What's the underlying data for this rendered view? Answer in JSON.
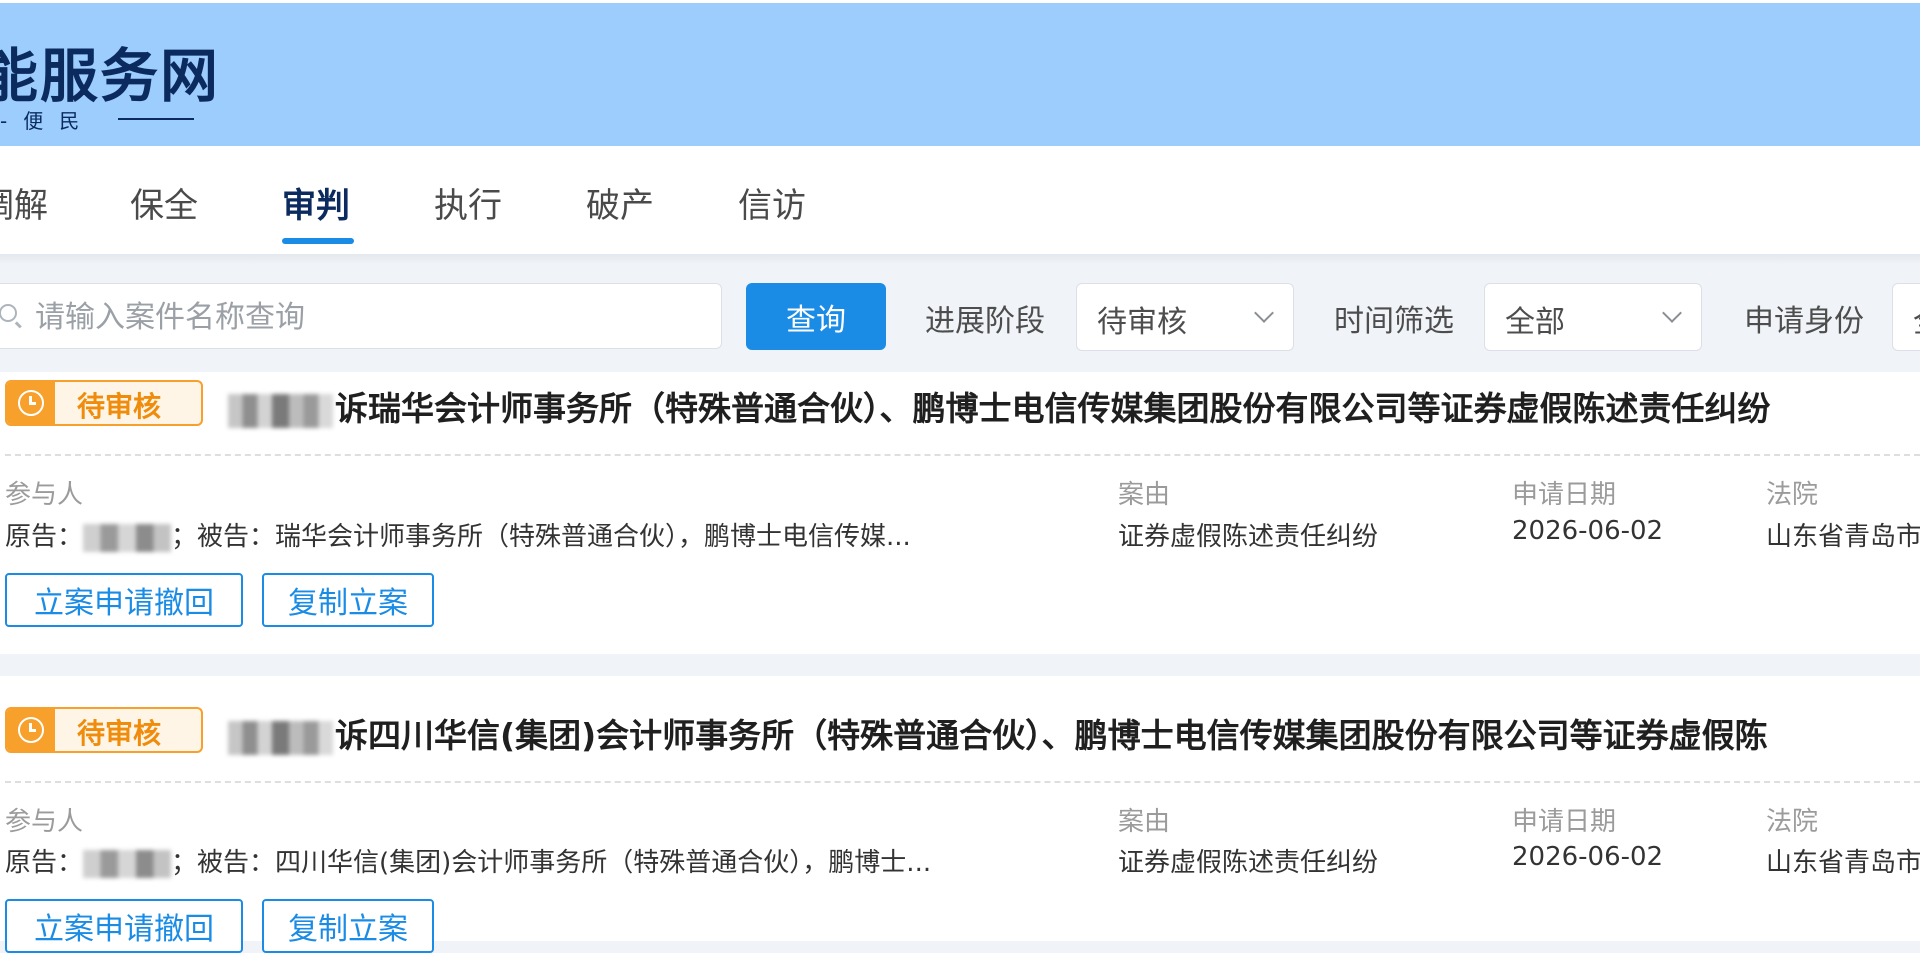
{
  "header": {
    "logo_title": "能服务网",
    "logo_subtitle": "便民",
    "logo_subtitle_lead": "-"
  },
  "nav": {
    "tabs": [
      {
        "label": "调解",
        "active": false
      },
      {
        "label": "保全",
        "active": false
      },
      {
        "label": "审判",
        "active": true
      },
      {
        "label": "执行",
        "active": false
      },
      {
        "label": "破产",
        "active": false
      },
      {
        "label": "信访",
        "active": false
      }
    ]
  },
  "search": {
    "placeholder": "请输入案件名称查询",
    "button_label": "查询"
  },
  "filters": {
    "stage_label": "进展阶段",
    "stage_value": "待审核",
    "time_label": "时间筛选",
    "time_value": "全部",
    "identity_label": "申请身份",
    "identity_value": "全"
  },
  "colors": {
    "header_bg": "#9ccdfd",
    "accent": "#1b8ce5",
    "pending": "#f7a02b"
  },
  "cases": [
    {
      "status": "待审核",
      "title": "诉瑞华会计师事务所（特殊普通合伙）、鹏博士电信传媒集团股份有限公司等证券虚假陈述责任纠纷",
      "participants_label": "参与人",
      "plaintiff_prefix": "原告：",
      "defendant_text": "；被告：瑞华会计师事务所（特殊普通合伙），鹏博士电信传媒...",
      "cause_label": "案由",
      "cause_value": "证券虚假陈述责任纠纷",
      "date_label": "申请日期",
      "date_value": "2026-06-02",
      "court_label": "法院",
      "court_value": "山东省青岛市",
      "actions": [
        "立案申请撤回",
        "复制立案"
      ]
    },
    {
      "status": "待审核",
      "title": "诉四川华信(集团)会计师事务所（特殊普通合伙）、鹏博士电信传媒集团股份有限公司等证券虚假陈",
      "participants_label": "参与人",
      "plaintiff_prefix": "原告：",
      "defendant_text": "；被告：四川华信(集团)会计师事务所（特殊普通合伙），鹏博士...",
      "cause_label": "案由",
      "cause_value": "证券虚假陈述责任纠纷",
      "date_label": "申请日期",
      "date_value": "2026-06-02",
      "court_label": "法院",
      "court_value": "山东省青岛市",
      "actions": [
        "立案申请撤回",
        "复制立案"
      ]
    }
  ]
}
